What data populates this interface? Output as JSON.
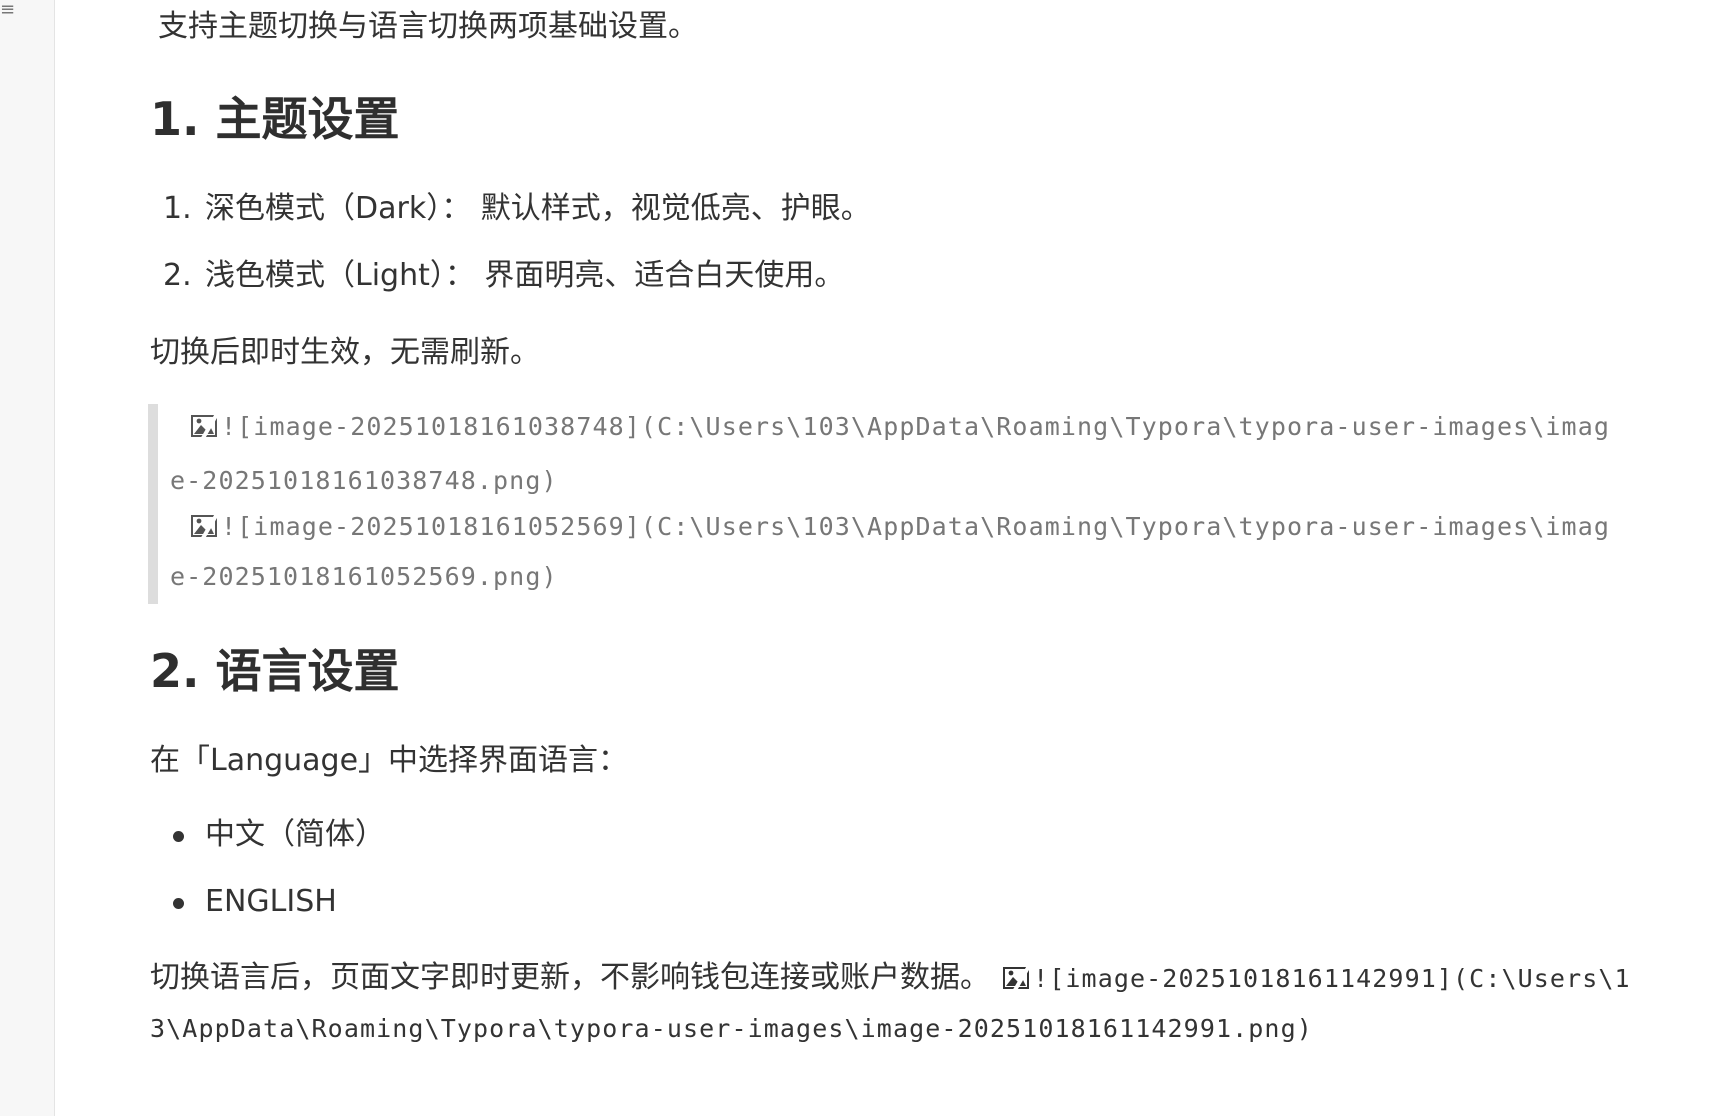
{
  "sidebar": {
    "glyph": "≡"
  },
  "content": {
    "intro": "支持主题切换与语言切换两项基础设置。",
    "section1": {
      "heading": "1. 主题设置",
      "items": [
        {
          "number": "1.",
          "text": "深色模式（Dark）： 默认样式，视觉低亮、护眼。"
        },
        {
          "number": "2.",
          "text": "浅色模式（Light）： 界面明亮、适合白天使用。"
        }
      ],
      "note": "切换后即时生效，无需刷新。",
      "quote_lines": [
        "![image-20251018161038748](C:\\Users\\103\\AppData\\Roaming\\Typora\\typora-user-images\\imag",
        "e-20251018161038748.png)",
        "![image-20251018161052569](C:\\Users\\103\\AppData\\Roaming\\Typora\\typora-user-images\\imag",
        "e-20251018161052569.png)"
      ]
    },
    "section2": {
      "heading": "2. 语言设置",
      "intro": "在「Language」中选择界面语言：",
      "items": [
        "中文（简体）",
        "ENGLISH"
      ],
      "final_text": "切换语言后，页面文字即时更新，不影响钱包连接或账户数据。",
      "final_img_line1": "![image-20251018161142991](C:\\Users\\1",
      "final_img_line2": "3\\AppData\\Roaming\\Typora\\typora-user-images\\image-20251018161142991.png)"
    }
  },
  "icons": {
    "broken_image": "broken-image-icon"
  }
}
